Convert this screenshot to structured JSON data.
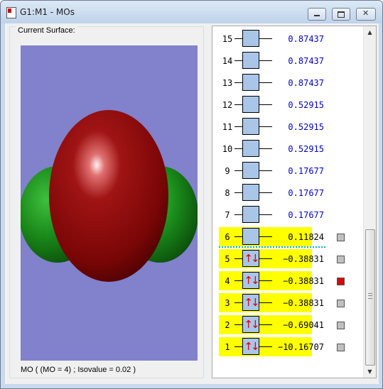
{
  "window": {
    "title": "G1:M1 - MOs"
  },
  "surface": {
    "group_label": "Current Surface:",
    "status": "MO ( (MO = 4) ; Isovalue = 0.02 )"
  },
  "orbitals": [
    {
      "index": "15",
      "energy": "0.87437",
      "occupied": false,
      "spin": "",
      "highlight": false,
      "selected": false
    },
    {
      "index": "14",
      "energy": "0.87437",
      "occupied": false,
      "spin": "",
      "highlight": false,
      "selected": false
    },
    {
      "index": "13",
      "energy": "0.87437",
      "occupied": false,
      "spin": "",
      "highlight": false,
      "selected": false
    },
    {
      "index": "12",
      "energy": "0.52915",
      "occupied": false,
      "spin": "",
      "highlight": false,
      "selected": false
    },
    {
      "index": "11",
      "energy": "0.52915",
      "occupied": false,
      "spin": "",
      "highlight": false,
      "selected": false
    },
    {
      "index": "10",
      "energy": "0.52915",
      "occupied": false,
      "spin": "",
      "highlight": false,
      "selected": false
    },
    {
      "index": "9",
      "energy": "0.17677",
      "occupied": false,
      "spin": "",
      "highlight": false,
      "selected": false
    },
    {
      "index": "8",
      "energy": "0.17677",
      "occupied": false,
      "spin": "",
      "highlight": false,
      "selected": false
    },
    {
      "index": "7",
      "energy": "0.17677",
      "occupied": false,
      "spin": "",
      "highlight": false,
      "selected": false
    },
    {
      "index": "6",
      "energy": "0.11824",
      "occupied": false,
      "spin": "",
      "highlight": true,
      "selected": false
    },
    {
      "index": "5",
      "energy": "−0.38831",
      "occupied": true,
      "spin": "↑↓",
      "highlight": true,
      "selected": false
    },
    {
      "index": "4",
      "energy": "−0.38831",
      "occupied": true,
      "spin": "↑↓",
      "highlight": true,
      "selected": true
    },
    {
      "index": "3",
      "energy": "−0.38831",
      "occupied": true,
      "spin": "↑↓",
      "highlight": true,
      "selected": false
    },
    {
      "index": "2",
      "energy": "−0.69041",
      "occupied": true,
      "spin": "↑↓",
      "highlight": true,
      "selected": false
    },
    {
      "index": "1",
      "energy": "−10.16707",
      "occupied": true,
      "spin": "↑↓",
      "highlight": true,
      "selected": false
    }
  ],
  "colors": {
    "viewport_bg": "#8181cc",
    "lobe_positive": "#8b0a0a",
    "lobe_negative": "#1a7a1a",
    "highlight": "#ffff00",
    "virtual_energy": "#0000c8",
    "occupied_energy": "#000000",
    "spin_arrows": "#e00000",
    "selected_marker": "#e00000",
    "unselected_marker": "#c0c0c0",
    "homo_lumo_divider": "#00b0d8"
  },
  "icons": {
    "app": "gaussview-document-icon",
    "minimize": "minimize-icon",
    "maximize": "maximize-icon",
    "close": "close-icon",
    "scroll_up": "scroll-up-arrow-icon",
    "scroll_down": "scroll-down-arrow-icon"
  }
}
